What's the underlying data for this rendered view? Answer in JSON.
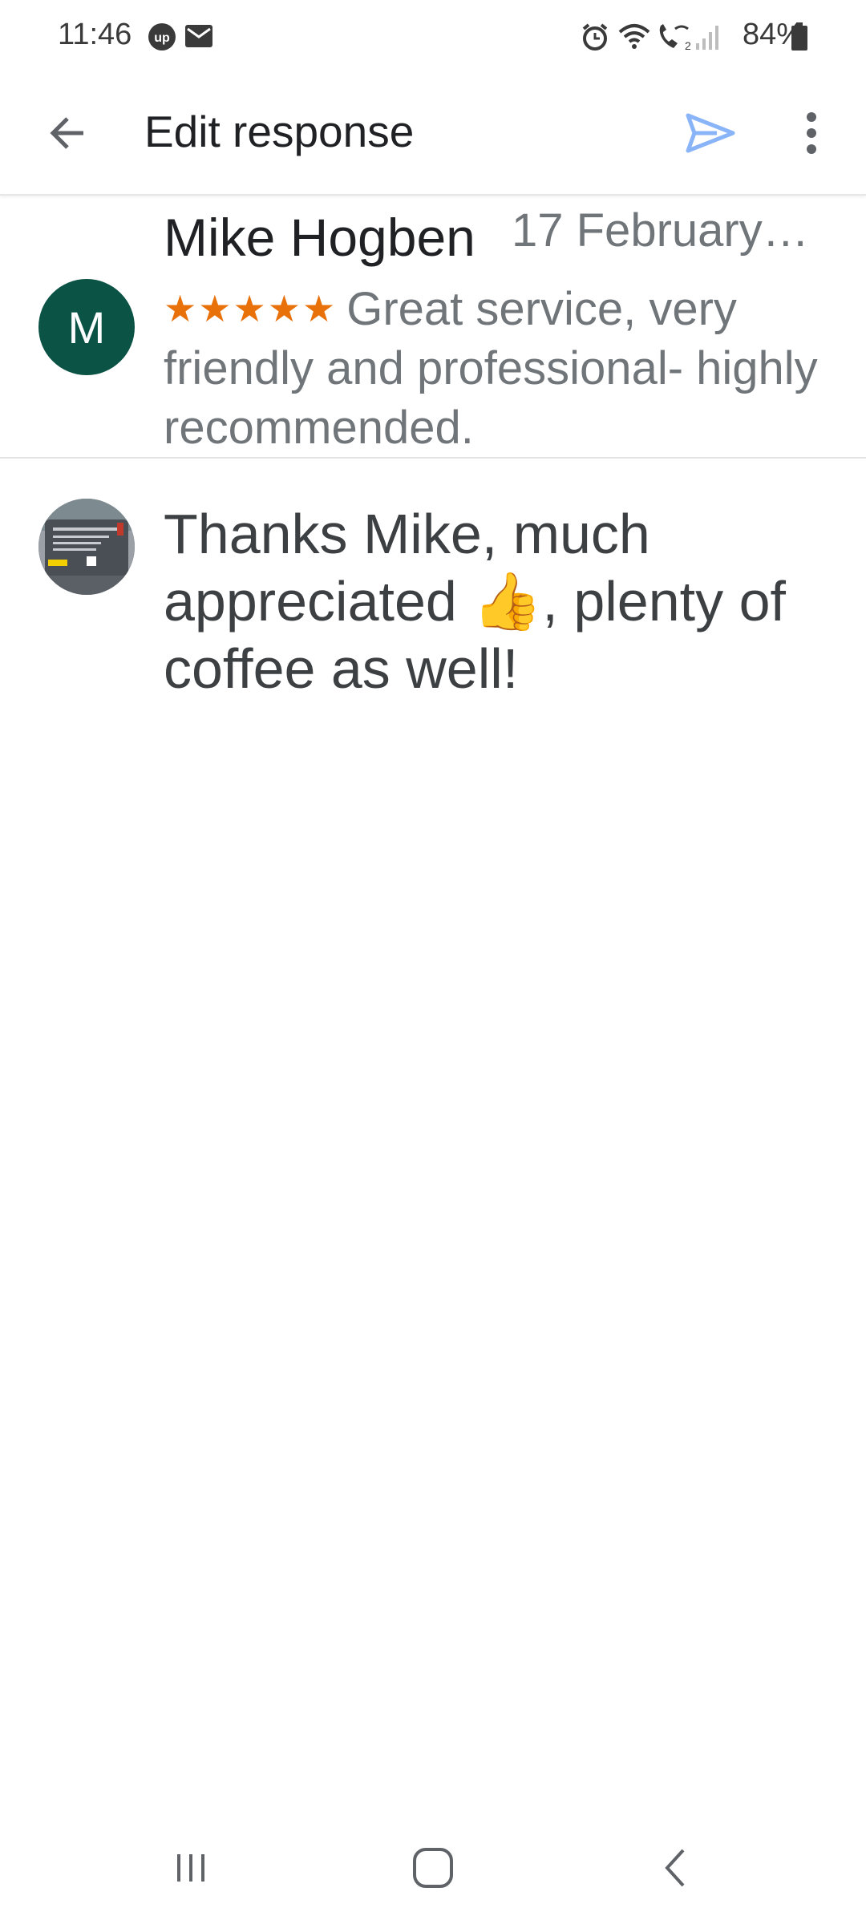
{
  "status_bar": {
    "time": "11:46",
    "battery": "84%",
    "icons": [
      "up-badge-icon",
      "mail-icon",
      "alarm-icon",
      "wifi-icon",
      "wifi-calling-icon",
      "signal-icon",
      "battery-icon"
    ]
  },
  "app_bar": {
    "title": "Edit response",
    "back_icon": "arrow-back-icon",
    "send_icon": "send-icon",
    "more_icon": "more-vert-icon",
    "accent_color": "#8ab4f8"
  },
  "review": {
    "avatar_initial": "M",
    "avatar_color": "#0b5345",
    "reviewer_name": "Mike Hogben",
    "date": "17 February…",
    "rating": 5,
    "stars": "★★★★★",
    "star_color": "#e8710a",
    "text": "Great service, very friendly and professional- highly recommended."
  },
  "response": {
    "owner_avatar": "business-van-photo",
    "text": "Thanks Mike, much appreciated 👍, plenty of coffee as well!"
  },
  "nav_bar": {
    "icons": [
      "recents-icon",
      "home-icon",
      "back-icon"
    ]
  }
}
